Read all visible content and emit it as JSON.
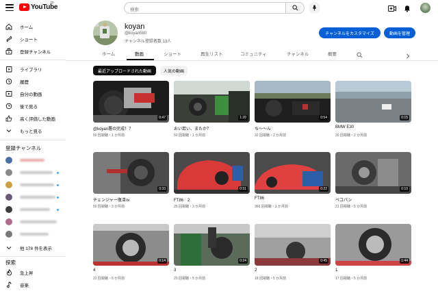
{
  "header": {
    "logo_text": "YouTube",
    "logo_country": "JP",
    "search_placeholder": "検索"
  },
  "sidebar": {
    "main": [
      {
        "label": "ホーム",
        "icon": "home-icon"
      },
      {
        "label": "ショート",
        "icon": "shorts-icon"
      },
      {
        "label": "登録チャンネル",
        "icon": "subscriptions-icon"
      }
    ],
    "library": [
      {
        "label": "ライブラリ",
        "icon": "library-icon"
      },
      {
        "label": "履歴",
        "icon": "history-icon"
      },
      {
        "label": "自分の動画",
        "icon": "your-videos-icon"
      },
      {
        "label": "後で見る",
        "icon": "watch-later-icon"
      },
      {
        "label": "高く評価した動画",
        "icon": "liked-icon"
      },
      {
        "label": "もっと見る",
        "icon": "chevron-down-icon"
      }
    ],
    "subscriptions_title": "登録チャンネル",
    "show_more": "他 178 件を表示",
    "explore_title": "探索",
    "explore": [
      {
        "label": "急上昇",
        "icon": "trending-icon"
      },
      {
        "label": "音楽",
        "icon": "music-icon"
      }
    ]
  },
  "channel": {
    "name": "koyan",
    "handle": "@koyan580",
    "subscribers": "チャンネル登録者数 13人",
    "customize_label": "チャンネルをカスタマイズ",
    "manage_label": "動画を管理"
  },
  "tabs": [
    "ホーム",
    "動画",
    "ショート",
    "再生リスト",
    "コミュニティ",
    "チャンネル",
    "概要"
  ],
  "active_tab": "動画",
  "chips": [
    "最近アップロードされた動画",
    "人気の動画"
  ],
  "videos": [
    {
      "title": "@koyan署の完成！？",
      "meta": "50 回視聴・1 か月前",
      "duration": "0:47"
    },
    {
      "title": "おい若い、またか？",
      "meta": "50 回視聴・1 か月前",
      "duration": "1:20"
    },
    {
      "title": "ち～～ん",
      "meta": "32 回視聴・2 か月前",
      "duration": "0:54"
    },
    {
      "title": "BMW E30",
      "meta": "20 回視聴・2 か月前",
      "duration": "0:15"
    },
    {
      "title": "チェンジャー復活ｗ",
      "meta": "50 回視聴・3 か月前",
      "duration": "0:33"
    },
    {
      "title": "FT86　2",
      "meta": "26 回視聴・3 か月前",
      "duration": "0:31"
    },
    {
      "title": "FT86",
      "meta": "366 回視聴・3 か月前",
      "duration": "0:22"
    },
    {
      "title": "ペコパン",
      "meta": "21 回視聴・5 か月前",
      "duration": "0:10"
    },
    {
      "title": "4",
      "meta": "22 回視聴・5 か月前",
      "duration": "0:14"
    },
    {
      "title": "3",
      "meta": "20 回視聴・5 か月前",
      "duration": "0:24"
    },
    {
      "title": "2",
      "meta": "18 回視聴・5 か月前",
      "duration": "0:45"
    },
    {
      "title": "1",
      "meta": "17 回視聴・5 か月前",
      "duration": "1:44"
    }
  ]
}
